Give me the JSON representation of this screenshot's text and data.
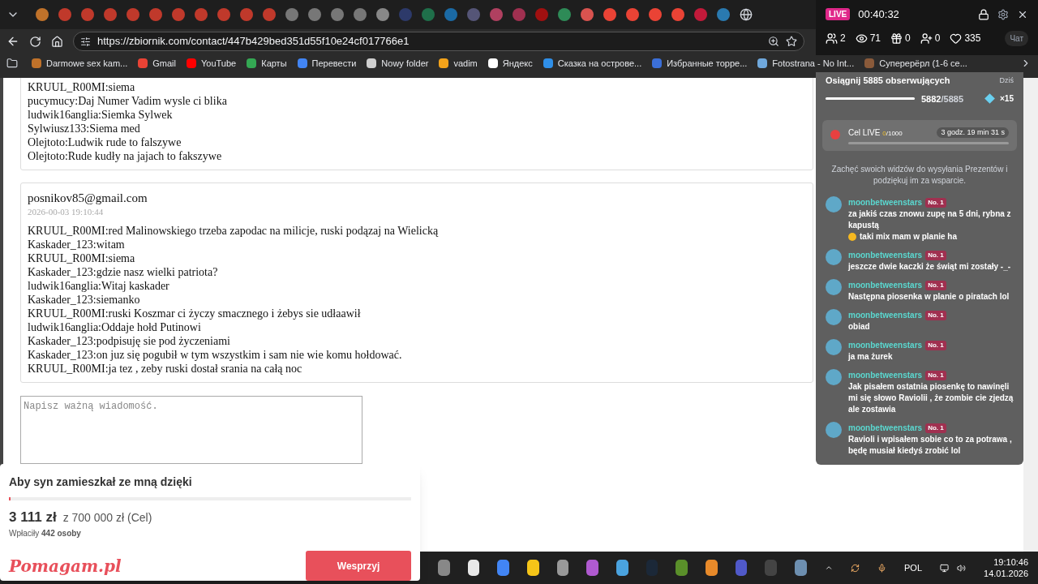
{
  "browser": {
    "url": "https://zbiornik.com/contact/447b429bed351d55f10e24cf017766e1",
    "bookmarks": [
      {
        "label": "Darmowe sex kam...",
        "color": "#c0722a"
      },
      {
        "label": "Gmail",
        "color": "#ea4335"
      },
      {
        "label": "YouTube",
        "color": "#ff0000"
      },
      {
        "label": "Карты",
        "color": "#34a853"
      },
      {
        "label": "Перевести",
        "color": "#4285f4"
      },
      {
        "label": "Nowy folder",
        "color": "#cfcfcf"
      },
      {
        "label": "vadim",
        "color": "#f4a31a"
      },
      {
        "label": "Яндекс",
        "color": "#ffffff"
      },
      {
        "label": "Сказка на острове...",
        "color": "#2f8fe8"
      },
      {
        "label": "Избранные торре...",
        "color": "#3b6fd8"
      },
      {
        "label": "Fotostrana - No Int...",
        "color": "#6fa8dc"
      },
      {
        "label": "Суперерёрл (1-6 се...",
        "color": "#8a5a3a"
      }
    ]
  },
  "messages": [
    {
      "lines": [
        "KRUUL_R00MI:siema",
        "pucymucy:Daj Numer Vadim wysle ci blika",
        "ludwik16anglia:Siemka Sylwek",
        "Sylwiusz133:Siema med",
        "Olejtoto:Ludwik rude to falszywe",
        "Olejtoto:Rude kudły na jajach to fakszywe"
      ]
    },
    {
      "sender": "posnikov85@gmail.com",
      "date": "2026-00-03 19:10:44",
      "lines": [
        "KRUUL_R00MI:red Malinowskiego trzeba zapodac na milicje, ruski podązaj na Wielicką",
        "Kaskader_123:witam",
        "KRUUL_R00MI:siema",
        "Kaskader_123:gdzie nasz wielki patriota?",
        "ludwik16anglia:Witaj kaskader",
        "Kaskader_123:siemanko",
        "KRUUL_R00MI:ruski Koszmar ci życzy smacznego i żebys sie udłaawił",
        "ludwik16anglia:Oddaje hołd Putinowi",
        "Kaskader_123:podpisuję sie pod życzeniami",
        "Kaskader_123:on juz się pogubił w tym wszystkim i sam nie wie komu hołdować.",
        "KRUUL_R00MI:ja tez , zeby ruski dostał srania na całą noc"
      ]
    }
  ],
  "reply": {
    "placeholder": "Napisz ważną wiadomość."
  },
  "live": {
    "badge": "LIVE",
    "time": "00:40:32",
    "stats": [
      {
        "kind": "users",
        "value": "2"
      },
      {
        "kind": "views",
        "value": "71"
      },
      {
        "kind": "gifts",
        "value": "0"
      },
      {
        "kind": "follows",
        "value": "0"
      },
      {
        "kind": "likes",
        "value": "335"
      }
    ],
    "chat_button": "Чат",
    "goal": {
      "title": "Osiągnij 5885 obserwujących",
      "current": "5882",
      "total": "/5885",
      "level": 0.999
    },
    "today": "Dziś",
    "multiplier": "×15",
    "live_goal": {
      "title": "Cel LIVE",
      "current": "0",
      "total": "/1000",
      "timer": "3 godz. 19 min 31 s",
      "level": 0
    },
    "hint": "Zachęć swoich widzów do wysyłania Prezentów i podziękuj im za wsparcie.",
    "comments": [
      {
        "user": "moonbetweenstars",
        "badge": "No. 1",
        "text": [
          "za jakiś czas znowu zupę na 5 dni, rybna z kapustą",
          "taki mix mam w planie ha"
        ]
      },
      {
        "user": "moonbetweenstars",
        "badge": "No. 1",
        "text": [
          "jeszcze dwie kaczki że świąt mi zostały -_-"
        ]
      },
      {
        "user": "moonbetweenstars",
        "badge": "No. 1",
        "text": [
          "Następna piosenka w planie o piratach lol"
        ]
      },
      {
        "user": "moonbetweenstars",
        "badge": "No. 1",
        "text": [
          "obiad"
        ]
      },
      {
        "user": "moonbetweenstars",
        "badge": "No. 1",
        "text": [
          "ja ma żurek"
        ]
      },
      {
        "user": "moonbetweenstars",
        "badge": "No. 1",
        "text": [
          "Jak pisałem ostatnia piosenkę to nawinęli mi się słowo Raviolii , że zombie cie zjedzą ale zostawia"
        ]
      },
      {
        "user": "moonbetweenstars",
        "badge": "No. 1",
        "text": [
          "Ravioli i wpisałem sobie co to za potrawa , będę musiał kiedyś zrobić lol"
        ]
      }
    ]
  },
  "fundraiser": {
    "title": "Aby syn zamieszkał ze mną dzięki",
    "level": 0.004,
    "raised": "3 111 zł",
    "goal": "z 700 000 zł (Cel)",
    "donors": "Wpłaciły **442 osoby**",
    "logo": "Pomagam.pl",
    "button": "Wesprzyj"
  },
  "taskbar": {
    "language": "POL",
    "time": "19:10:46",
    "date": "14.01.2026"
  }
}
